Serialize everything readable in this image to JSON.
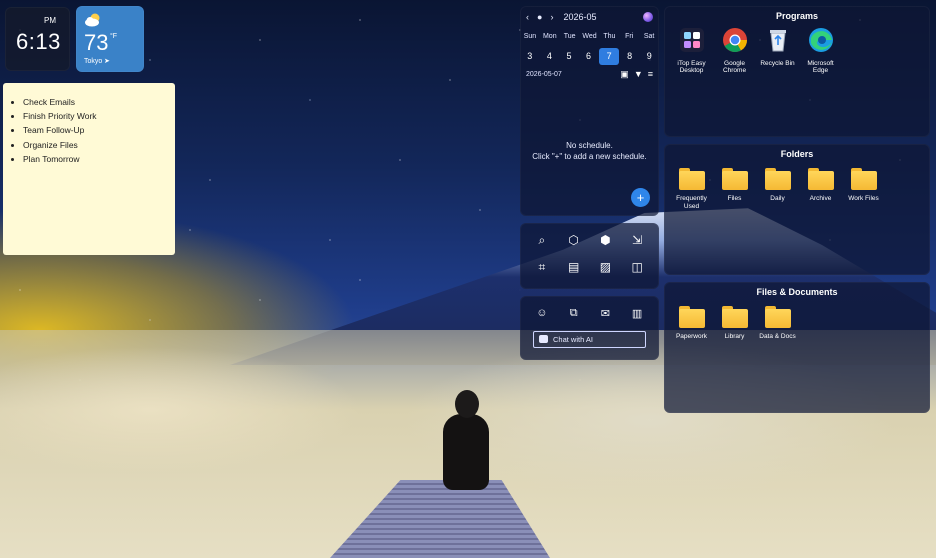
{
  "clock": {
    "ampm": "PM",
    "time": "6:13"
  },
  "weather": {
    "temp": "73",
    "unit": "°F",
    "city": "Tokyo",
    "icon": "partly-cloudy-icon"
  },
  "sticky_note": {
    "items": [
      "Check Emails",
      "Finish Priority Work",
      "Team Follow-Up",
      "Organize Files",
      "Plan Tomorrow"
    ]
  },
  "calendar": {
    "month": "2026-05",
    "weekdays": [
      "Sun",
      "Mon",
      "Tue",
      "Wed",
      "Thu",
      "Fri",
      "Sat"
    ],
    "days": [
      "3",
      "4",
      "5",
      "6",
      "7",
      "8",
      "9"
    ],
    "today": "7",
    "selected_date": "2026-05-07",
    "empty_line1": "No schedule.",
    "empty_line2": "Click \"+\" to add a new schedule.",
    "add_label": "+"
  },
  "ai": {
    "placeholder": "Chat with AI"
  },
  "programs": {
    "title": "Programs",
    "items": [
      {
        "label": "iTop Easy Desktop",
        "icon": "itop-easy-desktop-icon"
      },
      {
        "label": "Google Chrome",
        "icon": "chrome-icon"
      },
      {
        "label": "Recycle Bin",
        "icon": "recycle-bin-icon"
      },
      {
        "label": "Microsoft Edge",
        "icon": "edge-icon"
      }
    ]
  },
  "folders": {
    "title": "Folders",
    "items": [
      {
        "label": "Frequently Used"
      },
      {
        "label": "Files"
      },
      {
        "label": "Daily"
      },
      {
        "label": "Archive"
      },
      {
        "label": "Work Files"
      }
    ]
  },
  "docs": {
    "title": "Files & Documents",
    "items": [
      {
        "label": "Paperwork"
      },
      {
        "label": "Library"
      },
      {
        "label": "Data & Docs"
      }
    ]
  },
  "colors": {
    "accent": "#2f7de0",
    "note": "#fffad6",
    "weather": "#3a82c8"
  }
}
